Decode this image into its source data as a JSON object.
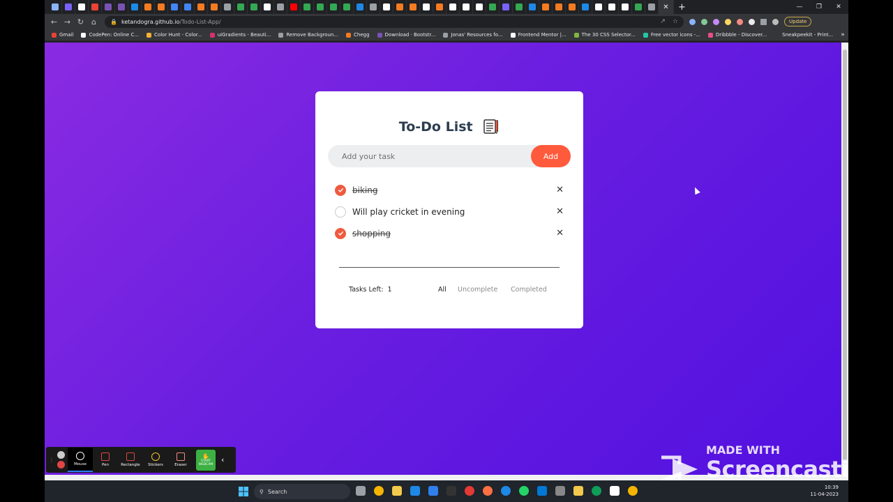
{
  "browser": {
    "url_host": "ketandogra.github.io",
    "url_path": "/Todo-List-App/",
    "update_label": "Update",
    "bookmarks": [
      {
        "label": "Gmail",
        "color": "#ea4335"
      },
      {
        "label": "CodePen: Online C...",
        "color": "#ffffff"
      },
      {
        "label": "Color Hunt - Color...",
        "color": "#f2b134"
      },
      {
        "label": "uiGradients - Beauti...",
        "color": "#d53369"
      },
      {
        "label": "Remove Backgroun...",
        "color": "#9aa0a6"
      },
      {
        "label": "Chegg",
        "color": "#f47b20"
      },
      {
        "label": "Download · Bootstr...",
        "color": "#7952b3"
      },
      {
        "label": "Jonas' Resources fo...",
        "color": "#9aa0a6"
      },
      {
        "label": "Frontend Mentor |...",
        "color": "#ffffff"
      },
      {
        "label": "The 30 CSS Selector...",
        "color": "#82b541"
      },
      {
        "label": "Free vector icons -...",
        "color": "#22c7a5"
      },
      {
        "label": "Dribbble - Discover...",
        "color": "#ea4c89"
      },
      {
        "label": "Sneakpeekit - Print...",
        "color": "#35363a"
      }
    ]
  },
  "app": {
    "title": "To-Do List",
    "input_placeholder": "Add your task",
    "add_label": "Add",
    "tasks": [
      {
        "text": "biking",
        "done": true
      },
      {
        "text": "Will play cricket in evening",
        "done": false
      },
      {
        "text": "shopping",
        "done": true
      }
    ],
    "delete_symbol": "✕",
    "tasks_left_label": "Tasks Left:",
    "tasks_left_count": "1",
    "filters": [
      {
        "label": "All",
        "active": true
      },
      {
        "label": "Uncomplete",
        "active": false
      },
      {
        "label": "Completed",
        "active": false
      }
    ],
    "accent_color": "#ff5a3c"
  },
  "recorder": {
    "tools": [
      {
        "label": "Mouse",
        "icon": "cursor-icon",
        "selected": true
      },
      {
        "label": "Pen",
        "icon": "pen-icon",
        "selected": false
      },
      {
        "label": "Rectangle",
        "icon": "rectangle-icon",
        "selected": false
      },
      {
        "label": "Stickers",
        "icon": "sticker-icon",
        "selected": false
      },
      {
        "label": "Eraser",
        "icon": "eraser-icon",
        "selected": false
      }
    ],
    "webcam_label": "START WEBCAM",
    "watermark_made": "MADE WITH",
    "watermark_brand": "Screencastify"
  },
  "taskbar": {
    "search_label": "Search",
    "time": "10:39",
    "date": "11-04-2023"
  }
}
